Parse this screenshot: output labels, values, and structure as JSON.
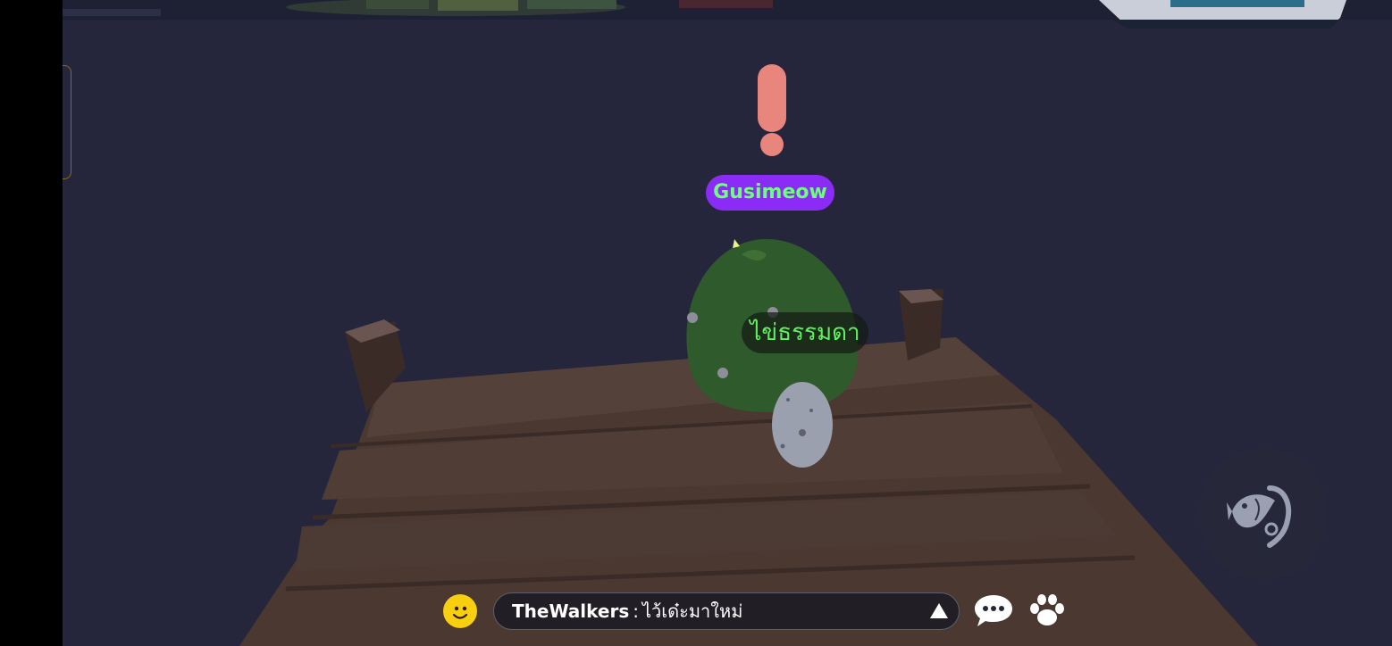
{
  "player": {
    "name": "Gusimeow"
  },
  "object": {
    "egg_name": "ไข่ธรรมดา"
  },
  "chat": {
    "sender": "TheWalkers",
    "separator": ":",
    "message": "ไว้เด๋ะมาใหม่"
  },
  "icons": {
    "alert": "exclamation-icon",
    "emoji": "smiley-face-icon",
    "chat": "speech-bubble-icon",
    "pets": "paw-icon",
    "fishing": "fishing-rod-icon",
    "expand": "triangle-up-icon"
  },
  "colors": {
    "name_tag_bg": "#8a2cf5",
    "name_tag_text": "#6eff7c",
    "egg_label_text": "#63f060",
    "alert": "#e8857d",
    "emoji": "#f7cf10"
  }
}
